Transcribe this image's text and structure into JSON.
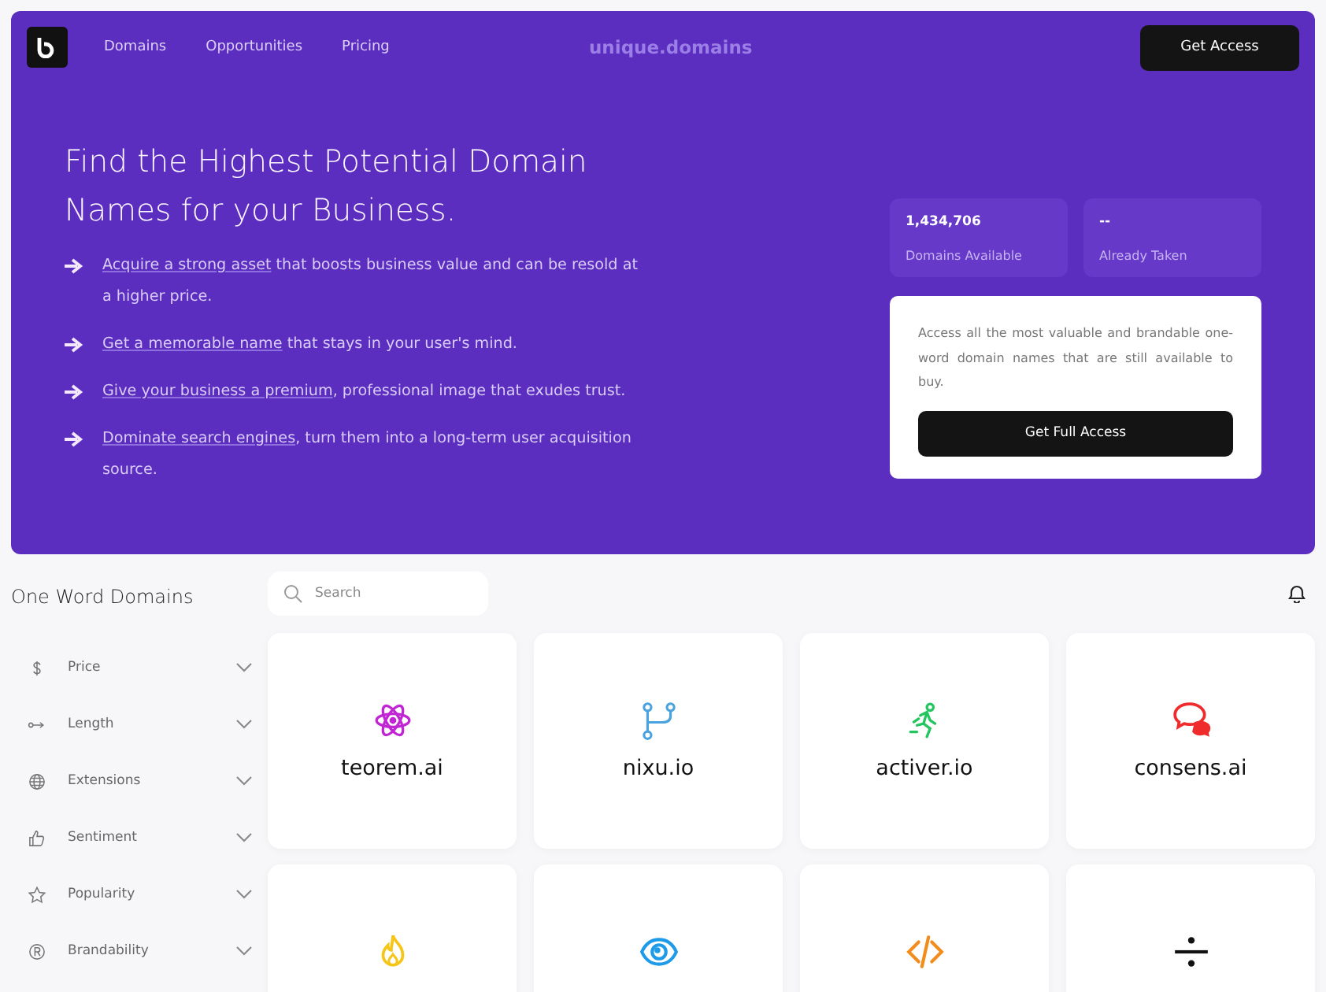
{
  "nav": {
    "links": [
      "Domains",
      "Opportunities",
      "Pricing"
    ],
    "brand": "unique.domains",
    "button": "Get Access"
  },
  "hero": {
    "title": "Find the Highest Potential Domain Names for your Business.",
    "bullets": [
      {
        "link": "Acquire a strong asset",
        "text": " that boosts business value and can be resold at a higher price."
      },
      {
        "link": "Get a memorable name",
        "text": " that stays in your user's mind."
      },
      {
        "link": "Give your business a premium",
        "text": ", professional image that exudes trust."
      },
      {
        "link": "Dominate search engines",
        "text": ", turn them into a long-term user acquisition source."
      }
    ],
    "stats": [
      {
        "value": "1,434,706",
        "label": "Domains Available"
      },
      {
        "value": "--",
        "label": "Already Taken"
      }
    ],
    "access": {
      "text": "Access all the most valuable and brandable one-word domain names that are still available to buy.",
      "button": "Get Full Access"
    }
  },
  "sidebar": {
    "title": "One Word Domains",
    "filters": [
      {
        "label": "Price",
        "kind": "dollar",
        "expanded": false
      },
      {
        "label": "Length",
        "kind": "length",
        "expanded": false
      },
      {
        "label": "Extensions",
        "kind": "globe",
        "expanded": false
      },
      {
        "label": "Sentiment",
        "kind": "thumb",
        "expanded": false
      },
      {
        "label": "Popularity",
        "kind": "star",
        "expanded": false
      },
      {
        "label": "Brandability",
        "kind": "registered",
        "expanded": false
      }
    ]
  },
  "search": {
    "placeholder": "Search"
  },
  "domains": [
    {
      "name": "teorem.ai",
      "kind": "atom",
      "color": "#c026d3"
    },
    {
      "name": "nixu.io",
      "kind": "branch",
      "color": "#4aa3df"
    },
    {
      "name": "activer.io",
      "kind": "runner",
      "color": "#22c55e"
    },
    {
      "name": "consens.ai",
      "kind": "chat",
      "color": "#ef2b2b"
    },
    {
      "kind": "flame",
      "color": "#f5c518"
    },
    {
      "kind": "eye",
      "color": "#1e9be8"
    },
    {
      "kind": "code",
      "color": "#f28c1c"
    },
    {
      "kind": "divide",
      "color": "#111111"
    }
  ]
}
